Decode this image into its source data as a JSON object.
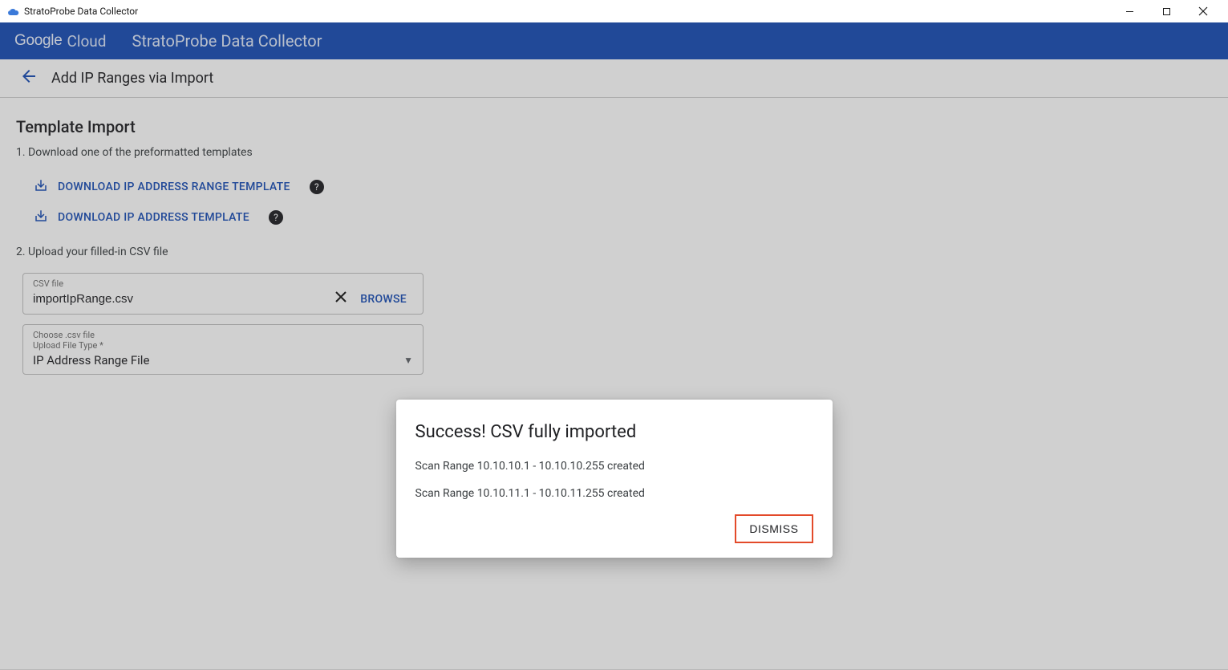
{
  "titlebar": {
    "title": "StratoProbe Data Collector"
  },
  "brand": {
    "logo_google": "Google",
    "logo_cloud": "Cloud",
    "app_name": "StratoProbe Data Collector"
  },
  "subheader": {
    "page_title": "Add IP Ranges via Import"
  },
  "template_import": {
    "section_title": "Template Import",
    "step1": "1. Download one of the preformatted templates",
    "links": [
      {
        "label": "DOWNLOAD IP ADDRESS RANGE TEMPLATE"
      },
      {
        "label": "DOWNLOAD IP ADDRESS TEMPLATE"
      }
    ],
    "step2": "2. Upload your filled-in CSV file",
    "csv_field": {
      "label": "CSV file",
      "value": "importIpRange.csv",
      "browse": "BROWSE"
    },
    "type_field": {
      "label_line1": "Choose .csv file",
      "label_line2": "Upload File Type *",
      "value": "IP Address Range File"
    }
  },
  "dialog": {
    "title": "Success! CSV fully imported",
    "messages": [
      "Scan Range 10.10.10.1 - 10.10.10.255 created",
      "Scan Range 10.10.11.1 - 10.10.11.255 created"
    ],
    "dismiss": "DISMISS"
  }
}
